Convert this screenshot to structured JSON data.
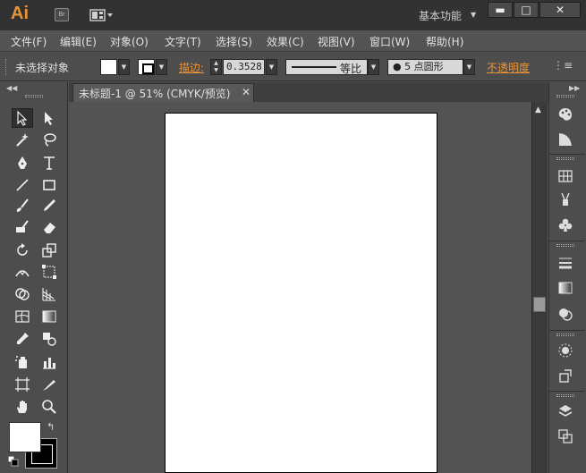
{
  "app": {
    "logo": "Ai",
    "bridge_label": "Br",
    "workspace": "基本功能"
  },
  "window_buttons": {
    "minimize": "▬",
    "maximize": "□",
    "close": "✕"
  },
  "menu": [
    "文件(F)",
    "编辑(E)",
    "对象(O)",
    "文字(T)",
    "选择(S)",
    "效果(C)",
    "视图(V)",
    "窗口(W)",
    "帮助(H)"
  ],
  "control_bar": {
    "selection_status": "未选择对象",
    "stroke_label": "描边:",
    "stroke_weight": "0.3528",
    "profile_label": "等比",
    "brush_label": "●  5 点圆形",
    "opacity_label": "不透明度"
  },
  "document": {
    "tab_title": "未标题-1 @ 51% (CMYK/预览)",
    "close": "✕"
  },
  "tools": [
    "selection-tool",
    "direct-selection-tool",
    "magic-wand-tool",
    "lasso-tool",
    "pen-tool",
    "type-tool",
    "line-segment-tool",
    "rectangle-tool",
    "paintbrush-tool",
    "pencil-tool",
    "blob-brush-tool",
    "eraser-tool",
    "rotate-tool",
    "scale-tool",
    "width-tool",
    "free-transform-tool",
    "shape-builder-tool",
    "perspective-grid-tool",
    "mesh-tool",
    "gradient-tool",
    "eyedropper-tool",
    "blend-tool",
    "symbol-sprayer-tool",
    "column-graph-tool",
    "artboard-tool",
    "slice-tool",
    "hand-tool",
    "zoom-tool"
  ],
  "colors": {
    "accent": "#e8953a",
    "dark": "#323232",
    "panel": "#4d4d4d",
    "canvas": "#535353"
  }
}
